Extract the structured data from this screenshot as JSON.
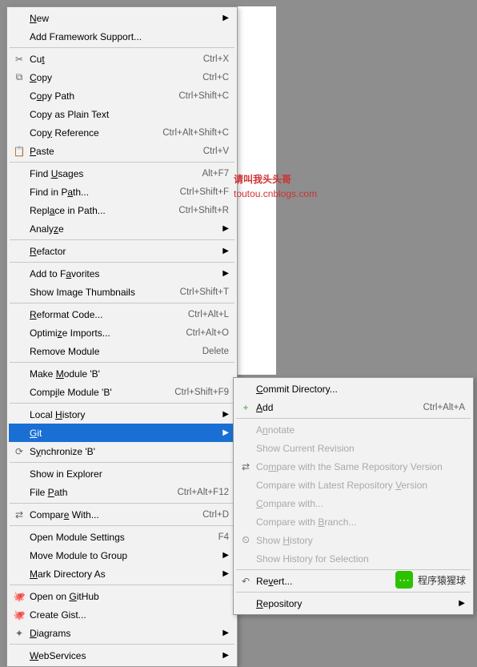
{
  "watermark": {
    "line1": "请叫我头头哥",
    "line2": "toutou.cnblogs.com"
  },
  "footer": {
    "text": "程序猿猩球"
  },
  "main_menu": {
    "groups": [
      [
        {
          "icon": "",
          "html": "<span class='u'>N</span>ew",
          "shortcut": "",
          "arrow": true
        },
        {
          "icon": "",
          "html": "Add Framework Support...",
          "shortcut": ""
        }
      ],
      [
        {
          "icon": "✂",
          "html": "Cu<span class='u'>t</span>",
          "shortcut": "Ctrl+X"
        },
        {
          "icon": "⧉",
          "html": "<span class='u'>C</span>opy",
          "shortcut": "Ctrl+C"
        },
        {
          "icon": "",
          "html": "C<span class='u'>o</span>py Path",
          "shortcut": "Ctrl+Shift+C"
        },
        {
          "icon": "",
          "html": "Copy as Plain Text",
          "shortcut": ""
        },
        {
          "icon": "",
          "html": "Cop<span class='u'>y</span> Reference",
          "shortcut": "Ctrl+Alt+Shift+C"
        },
        {
          "icon": "📋",
          "html": "<span class='u'>P</span>aste",
          "shortcut": "Ctrl+V"
        }
      ],
      [
        {
          "icon": "",
          "html": "Find <span class='u'>U</span>sages",
          "shortcut": "Alt+F7"
        },
        {
          "icon": "",
          "html": "Find in P<span class='u'>a</span>th...",
          "shortcut": "Ctrl+Shift+F"
        },
        {
          "icon": "",
          "html": "Repl<span class='u'>a</span>ce in Path...",
          "shortcut": "Ctrl+Shift+R"
        },
        {
          "icon": "",
          "html": "Analy<span class='u'>z</span>e",
          "shortcut": "",
          "arrow": true
        }
      ],
      [
        {
          "icon": "",
          "html": "<span class='u'>R</span>efactor",
          "shortcut": "",
          "arrow": true
        }
      ],
      [
        {
          "icon": "",
          "html": "Add to F<span class='u'>a</span>vorites",
          "shortcut": "",
          "arrow": true
        },
        {
          "icon": "",
          "html": "Show Image Thumbnails",
          "shortcut": "Ctrl+Shift+T"
        }
      ],
      [
        {
          "icon": "",
          "html": "<span class='u'>R</span>eformat Code...",
          "shortcut": "Ctrl+Alt+L"
        },
        {
          "icon": "",
          "html": "Optimi<span class='u'>z</span>e Imports...",
          "shortcut": "Ctrl+Alt+O"
        },
        {
          "icon": "",
          "html": "Remove Module",
          "shortcut": "Delete"
        }
      ],
      [
        {
          "icon": "",
          "html": "Make <span class='u'>M</span>odule 'B'",
          "shortcut": ""
        },
        {
          "icon": "",
          "html": "Comp<span class='u'>i</span>le Module 'B'",
          "shortcut": "Ctrl+Shift+F9"
        }
      ],
      [
        {
          "icon": "",
          "html": "Local <span class='u'>H</span>istory",
          "shortcut": "",
          "arrow": true
        },
        {
          "icon": "",
          "html": "<span class='u'>G</span>it",
          "shortcut": "",
          "arrow": true,
          "selected": true
        },
        {
          "icon": "⟳",
          "html": "S<span class='u'>y</span>nchronize 'B'",
          "shortcut": ""
        }
      ],
      [
        {
          "icon": "",
          "html": "Show in Explorer",
          "shortcut": ""
        },
        {
          "icon": "",
          "html": "File <span class='u'>P</span>ath",
          "shortcut": "Ctrl+Alt+F12"
        }
      ],
      [
        {
          "icon": "⇄",
          "html": "Compar<span class='u'>e</span> With...",
          "shortcut": "Ctrl+D"
        }
      ],
      [
        {
          "icon": "",
          "html": "Open Module Settings",
          "shortcut": "F4"
        },
        {
          "icon": "",
          "html": "Move Module to Group",
          "shortcut": "",
          "arrow": true
        },
        {
          "icon": "",
          "html": "<span class='u'>M</span>ark Directory As",
          "shortcut": "",
          "arrow": true
        }
      ],
      [
        {
          "icon": "🐙",
          "html": "Open on <span class='u'>G</span>itHub",
          "shortcut": ""
        },
        {
          "icon": "🐙",
          "html": "Create Gist...",
          "shortcut": ""
        },
        {
          "icon": "✦",
          "html": "<span class='u'>D</span>iagrams",
          "shortcut": "",
          "arrow": true
        }
      ],
      [
        {
          "icon": "",
          "html": "<span class='u'>W</span>ebServices",
          "shortcut": "",
          "arrow": true
        }
      ]
    ]
  },
  "sub_menu": {
    "groups": [
      [
        {
          "icon": "",
          "html": "<span class='u'>C</span>ommit Directory...",
          "shortcut": ""
        },
        {
          "icon": "+",
          "iconColor": "#4a9b4a",
          "html": "<span class='u'>A</span>dd",
          "shortcut": "Ctrl+Alt+A"
        }
      ],
      [
        {
          "icon": "",
          "html": "A<span class='u'>n</span>notate",
          "disabled": true
        },
        {
          "icon": "",
          "html": "Show Current Revision",
          "disabled": true
        },
        {
          "icon": "⇄",
          "html": "Co<span class='u'>m</span>pare with the Same Repository Version",
          "disabled": true
        },
        {
          "icon": "",
          "html": "Compare with Latest Repository <span class='u'>V</span>ersion",
          "disabled": true
        },
        {
          "icon": "",
          "html": "<span class='u'>C</span>ompare with...",
          "disabled": true
        },
        {
          "icon": "",
          "html": "Compare with <span class='u'>B</span>ranch...",
          "disabled": true
        },
        {
          "icon": "⏲",
          "html": "Show <span class='u'>H</span>istory",
          "disabled": true
        },
        {
          "icon": "",
          "html": "Show History for Selection",
          "disabled": true
        }
      ],
      [
        {
          "icon": "↶",
          "html": "Re<span class='u'>v</span>ert...",
          "shortcut": ""
        }
      ],
      [
        {
          "icon": "",
          "html": "<span class='u'>R</span>epository",
          "shortcut": "",
          "arrow": true
        }
      ]
    ]
  }
}
